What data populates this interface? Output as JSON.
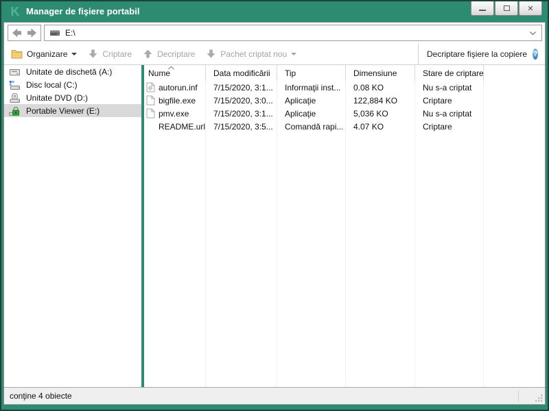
{
  "window": {
    "title": "Manager de fişiere portabil",
    "logo_glyph": "K",
    "close_glyph": "✕"
  },
  "navigation": {
    "back_icon": "back-arrow",
    "forward_icon": "forward-arrow",
    "address": "E:\\"
  },
  "toolbar": {
    "organize": "Organizare",
    "encrypt": "Criptare",
    "decrypt": "Decriptare",
    "new_package": "Pachet criptat nou",
    "decrypt_on_copy": "Decriptare fişiere la copiere",
    "help_glyph": "?"
  },
  "sidebar": {
    "items": [
      {
        "label": "Unitate de dischetă (A:)",
        "icon": "floppy-drive",
        "selected": false
      },
      {
        "label": "Disc local (C:)",
        "icon": "hard-drive",
        "selected": false
      },
      {
        "label": "Unitate DVD (D:)",
        "icon": "dvd-drive",
        "selected": false
      },
      {
        "label": "Portable Viewer (E:)",
        "icon": "locked-drive",
        "selected": true
      }
    ]
  },
  "file_list": {
    "columns": [
      "Nume",
      "Data modificării",
      "Tip",
      "Dimensiune",
      "Stare de criptare"
    ],
    "sort": {
      "column": "Nume",
      "direction": "asc"
    },
    "rows": [
      {
        "icon": "setup-file",
        "name": "autorun.inf",
        "modified": "7/15/2020, 3:1...",
        "type": "Informaţii inst...",
        "size": "0.08 KO",
        "status": "Nu s-a criptat"
      },
      {
        "icon": "blank-file",
        "name": "bigfile.exe",
        "modified": "7/15/2020, 3:0...",
        "type": "Aplicaţie",
        "size": "122,884 KO",
        "status": "Criptare"
      },
      {
        "icon": "blank-file",
        "name": "pmv.exe",
        "modified": "7/15/2020, 3:1...",
        "type": "Aplicaţie",
        "size": "5,036 KO",
        "status": "Nu s-a criptat"
      },
      {
        "icon": "none",
        "name": "README.url",
        "modified": "7/15/2020, 3:5...",
        "type": "Comandă rapi...",
        "size": "4.07 KO",
        "status": "Criptare"
      }
    ]
  },
  "status_bar": {
    "text": "conţine 4 obiecte"
  },
  "colors": {
    "accent_green": "#2E8B73",
    "frame_edge": "#1C4237",
    "logo_green": "#4DB795",
    "lock_green": "#2FA436",
    "folder_yellow": "#F3CE77",
    "help_blue": "#3B7FC4",
    "selection_gray": "#D9D9D9",
    "disabled_gray": "#A3A3A3"
  }
}
